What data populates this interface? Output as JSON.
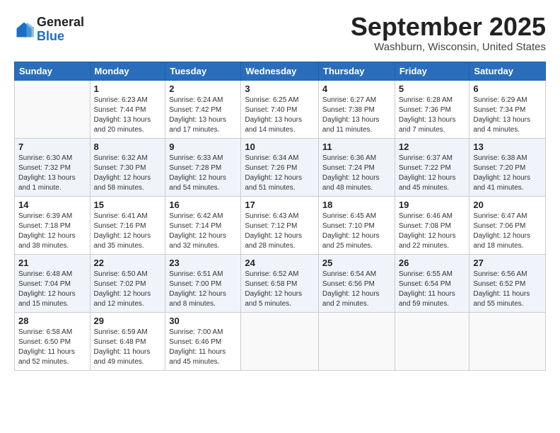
{
  "header": {
    "logo_line1": "General",
    "logo_line2": "Blue",
    "month_title": "September 2025",
    "location": "Washburn, Wisconsin, United States"
  },
  "weekdays": [
    "Sunday",
    "Monday",
    "Tuesday",
    "Wednesday",
    "Thursday",
    "Friday",
    "Saturday"
  ],
  "weeks": [
    [
      {
        "day": "",
        "sunrise": "",
        "sunset": "",
        "daylight": ""
      },
      {
        "day": "1",
        "sunrise": "Sunrise: 6:23 AM",
        "sunset": "Sunset: 7:44 PM",
        "daylight": "Daylight: 13 hours and 20 minutes."
      },
      {
        "day": "2",
        "sunrise": "Sunrise: 6:24 AM",
        "sunset": "Sunset: 7:42 PM",
        "daylight": "Daylight: 13 hours and 17 minutes."
      },
      {
        "day": "3",
        "sunrise": "Sunrise: 6:25 AM",
        "sunset": "Sunset: 7:40 PM",
        "daylight": "Daylight: 13 hours and 14 minutes."
      },
      {
        "day": "4",
        "sunrise": "Sunrise: 6:27 AM",
        "sunset": "Sunset: 7:38 PM",
        "daylight": "Daylight: 13 hours and 11 minutes."
      },
      {
        "day": "5",
        "sunrise": "Sunrise: 6:28 AM",
        "sunset": "Sunset: 7:36 PM",
        "daylight": "Daylight: 13 hours and 7 minutes."
      },
      {
        "day": "6",
        "sunrise": "Sunrise: 6:29 AM",
        "sunset": "Sunset: 7:34 PM",
        "daylight": "Daylight: 13 hours and 4 minutes."
      }
    ],
    [
      {
        "day": "7",
        "sunrise": "Sunrise: 6:30 AM",
        "sunset": "Sunset: 7:32 PM",
        "daylight": "Daylight: 13 hours and 1 minute."
      },
      {
        "day": "8",
        "sunrise": "Sunrise: 6:32 AM",
        "sunset": "Sunset: 7:30 PM",
        "daylight": "Daylight: 12 hours and 58 minutes."
      },
      {
        "day": "9",
        "sunrise": "Sunrise: 6:33 AM",
        "sunset": "Sunset: 7:28 PM",
        "daylight": "Daylight: 12 hours and 54 minutes."
      },
      {
        "day": "10",
        "sunrise": "Sunrise: 6:34 AM",
        "sunset": "Sunset: 7:26 PM",
        "daylight": "Daylight: 12 hours and 51 minutes."
      },
      {
        "day": "11",
        "sunrise": "Sunrise: 6:36 AM",
        "sunset": "Sunset: 7:24 PM",
        "daylight": "Daylight: 12 hours and 48 minutes."
      },
      {
        "day": "12",
        "sunrise": "Sunrise: 6:37 AM",
        "sunset": "Sunset: 7:22 PM",
        "daylight": "Daylight: 12 hours and 45 minutes."
      },
      {
        "day": "13",
        "sunrise": "Sunrise: 6:38 AM",
        "sunset": "Sunset: 7:20 PM",
        "daylight": "Daylight: 12 hours and 41 minutes."
      }
    ],
    [
      {
        "day": "14",
        "sunrise": "Sunrise: 6:39 AM",
        "sunset": "Sunset: 7:18 PM",
        "daylight": "Daylight: 12 hours and 38 minutes."
      },
      {
        "day": "15",
        "sunrise": "Sunrise: 6:41 AM",
        "sunset": "Sunset: 7:16 PM",
        "daylight": "Daylight: 12 hours and 35 minutes."
      },
      {
        "day": "16",
        "sunrise": "Sunrise: 6:42 AM",
        "sunset": "Sunset: 7:14 PM",
        "daylight": "Daylight: 12 hours and 32 minutes."
      },
      {
        "day": "17",
        "sunrise": "Sunrise: 6:43 AM",
        "sunset": "Sunset: 7:12 PM",
        "daylight": "Daylight: 12 hours and 28 minutes."
      },
      {
        "day": "18",
        "sunrise": "Sunrise: 6:45 AM",
        "sunset": "Sunset: 7:10 PM",
        "daylight": "Daylight: 12 hours and 25 minutes."
      },
      {
        "day": "19",
        "sunrise": "Sunrise: 6:46 AM",
        "sunset": "Sunset: 7:08 PM",
        "daylight": "Daylight: 12 hours and 22 minutes."
      },
      {
        "day": "20",
        "sunrise": "Sunrise: 6:47 AM",
        "sunset": "Sunset: 7:06 PM",
        "daylight": "Daylight: 12 hours and 18 minutes."
      }
    ],
    [
      {
        "day": "21",
        "sunrise": "Sunrise: 6:48 AM",
        "sunset": "Sunset: 7:04 PM",
        "daylight": "Daylight: 12 hours and 15 minutes."
      },
      {
        "day": "22",
        "sunrise": "Sunrise: 6:50 AM",
        "sunset": "Sunset: 7:02 PM",
        "daylight": "Daylight: 12 hours and 12 minutes."
      },
      {
        "day": "23",
        "sunrise": "Sunrise: 6:51 AM",
        "sunset": "Sunset: 7:00 PM",
        "daylight": "Daylight: 12 hours and 8 minutes."
      },
      {
        "day": "24",
        "sunrise": "Sunrise: 6:52 AM",
        "sunset": "Sunset: 6:58 PM",
        "daylight": "Daylight: 12 hours and 5 minutes."
      },
      {
        "day": "25",
        "sunrise": "Sunrise: 6:54 AM",
        "sunset": "Sunset: 6:56 PM",
        "daylight": "Daylight: 12 hours and 2 minutes."
      },
      {
        "day": "26",
        "sunrise": "Sunrise: 6:55 AM",
        "sunset": "Sunset: 6:54 PM",
        "daylight": "Daylight: 11 hours and 59 minutes."
      },
      {
        "day": "27",
        "sunrise": "Sunrise: 6:56 AM",
        "sunset": "Sunset: 6:52 PM",
        "daylight": "Daylight: 11 hours and 55 minutes."
      }
    ],
    [
      {
        "day": "28",
        "sunrise": "Sunrise: 6:58 AM",
        "sunset": "Sunset: 6:50 PM",
        "daylight": "Daylight: 11 hours and 52 minutes."
      },
      {
        "day": "29",
        "sunrise": "Sunrise: 6:59 AM",
        "sunset": "Sunset: 6:48 PM",
        "daylight": "Daylight: 11 hours and 49 minutes."
      },
      {
        "day": "30",
        "sunrise": "Sunrise: 7:00 AM",
        "sunset": "Sunset: 6:46 PM",
        "daylight": "Daylight: 11 hours and 45 minutes."
      },
      {
        "day": "",
        "sunrise": "",
        "sunset": "",
        "daylight": ""
      },
      {
        "day": "",
        "sunrise": "",
        "sunset": "",
        "daylight": ""
      },
      {
        "day": "",
        "sunrise": "",
        "sunset": "",
        "daylight": ""
      },
      {
        "day": "",
        "sunrise": "",
        "sunset": "",
        "daylight": ""
      }
    ]
  ]
}
